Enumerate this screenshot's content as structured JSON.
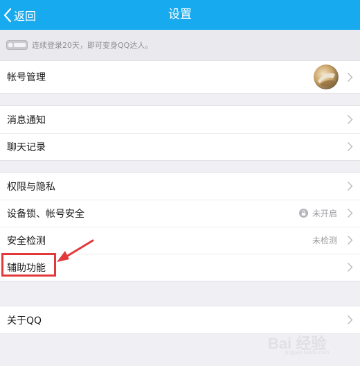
{
  "header": {
    "back_label": "返回",
    "title": "设置"
  },
  "tip": {
    "text": "连续登录20天，即可变身QQ达人。"
  },
  "groups": [
    {
      "items": [
        {
          "label": "帐号管理",
          "value": "",
          "icon": "avatar"
        }
      ]
    },
    {
      "items": [
        {
          "label": "消息通知",
          "value": ""
        },
        {
          "label": "聊天记录",
          "value": ""
        }
      ]
    },
    {
      "items": [
        {
          "label": "权限与隐私",
          "value": ""
        },
        {
          "label": "设备锁、帐号安全",
          "value": "未开启",
          "icon": "lock-icon"
        },
        {
          "label": "安全检测",
          "value": "未检测"
        },
        {
          "label": "辅助功能",
          "value": ""
        }
      ]
    },
    {
      "items": [
        {
          "label": "关于QQ",
          "value": ""
        }
      ]
    }
  ],
  "annotation": {
    "color": "#e3383a",
    "target": "辅助功能"
  },
  "watermark": {
    "main": "Bai 经验",
    "sub": "jingyan.baidu.com"
  },
  "colors": {
    "titlebar": "#17aaee",
    "background": "#f0f0f4"
  }
}
